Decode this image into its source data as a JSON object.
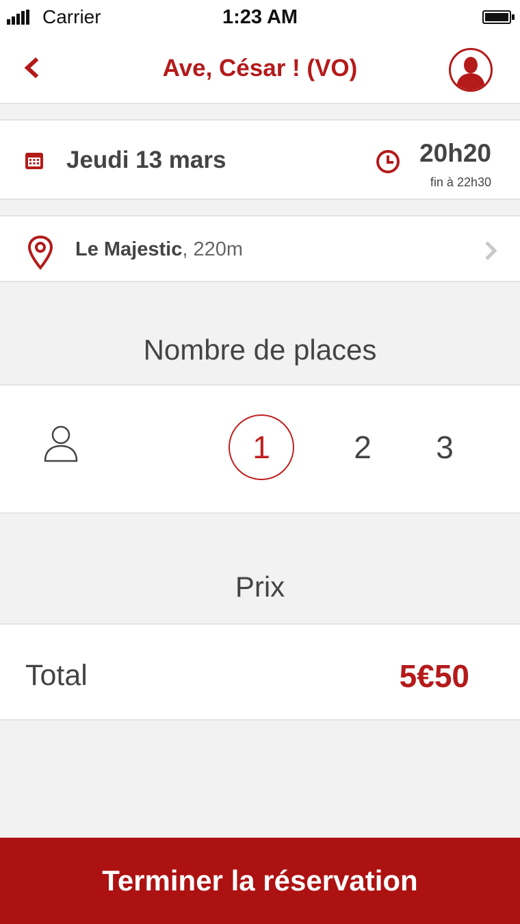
{
  "status_bar": {
    "carrier": "Carrier",
    "time": "1:23 AM"
  },
  "nav": {
    "title": "Ave, César ! (VO)",
    "icons": {
      "back": "chevron-left-icon",
      "profile": "user-profile-icon"
    }
  },
  "showtime": {
    "date": "Jeudi 13 mars",
    "time": "20h20",
    "end": "fin à 22h30",
    "icons": {
      "date": "calendar-icon",
      "time": "clock-icon"
    }
  },
  "cinema": {
    "name": "Le Majestic",
    "distance": ", 220m",
    "icons": {
      "location": "map-pin-icon",
      "more": "chevron-right-icon"
    }
  },
  "places": {
    "title": "Nombre de places",
    "options": [
      "1",
      "2",
      "3"
    ],
    "selected": "1"
  },
  "price": {
    "title": "Prix",
    "total_label": "Total",
    "total_value": "5€50"
  },
  "cta": {
    "label": "Terminer la réservation"
  },
  "colors": {
    "accent": "#b41a1a",
    "button": "#ad1212",
    "background": "#f2f2f2",
    "text": "#444444"
  }
}
